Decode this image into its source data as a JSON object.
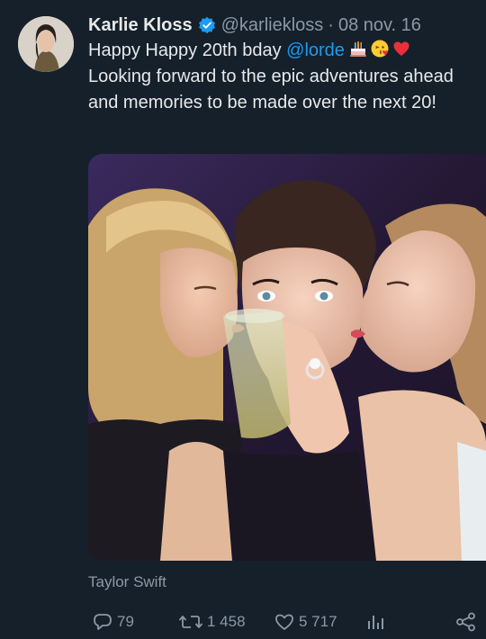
{
  "tweet": {
    "author_name": "Karlie Kloss",
    "handle": "@karliekloss",
    "separator": "·",
    "date": "08 nov. 16",
    "text_part1": "Happy Happy 20th bday ",
    "mention": "@lorde",
    "text_part2": "Looking forward to the epic adventures ahead and memories to be made over the next 20!",
    "emojis": [
      "birthday-cake",
      "kissing-face",
      "red-heart"
    ]
  },
  "photo": {
    "tagged_user": "Taylor Swift"
  },
  "actions": {
    "replies": "79",
    "retweets": "1 458",
    "likes": "5 717"
  },
  "colors": {
    "background": "#15202b",
    "text": "#e7e9ea",
    "muted": "#8b98a5",
    "accent": "#1d9bf0"
  }
}
